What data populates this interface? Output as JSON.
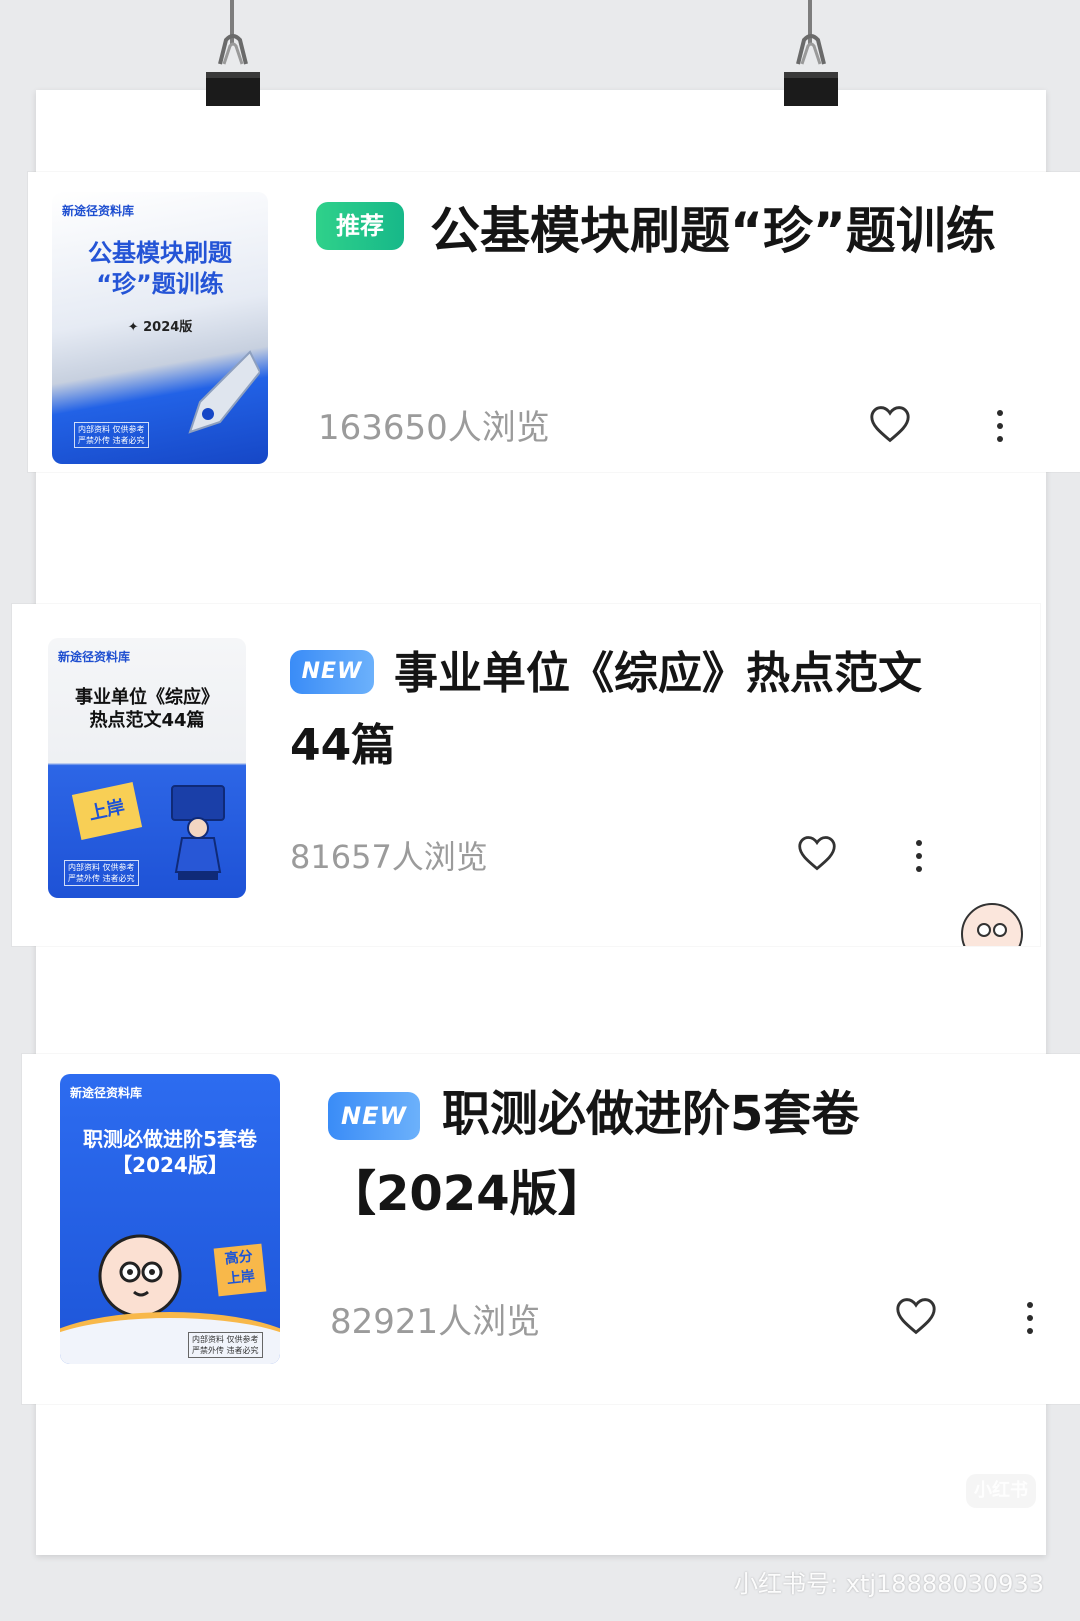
{
  "items": [
    {
      "badge": "推荐",
      "title": "公基模块刷题“珍”题训练",
      "views": "163650人浏览",
      "cover": {
        "brand": "新途径资料库",
        "title_line1": "公基模块刷题",
        "title_line2": "“珍”题训练",
        "edition": "✦ 2024版",
        "fine_1": "内部资料 仅供参考",
        "fine_2": "严禁外传 违者必究"
      }
    },
    {
      "badge": "NEW",
      "title": "事业单位《综应》热点范文44篇",
      "views": "81657人浏览",
      "cover": {
        "brand": "新途径资料库",
        "title_line1": "事业单位《综应》",
        "title_line2": "热点范文44篇",
        "sticker": "上岸",
        "fine_1": "内部资料 仅供参考",
        "fine_2": "严禁外传 违者必究"
      }
    },
    {
      "badge": "NEW",
      "title": "职测必做进阶5套卷【2024版】",
      "views": "82921人浏览",
      "cover": {
        "brand": "新途径资料库",
        "title_line1": "职测必做进阶5套卷",
        "title_line2": "【2024版】",
        "tag": "高分上岸",
        "fine_1": "内部资料 仅供参考",
        "fine_2": "严禁外传 违者必究"
      }
    }
  ],
  "watermark": {
    "logo": "小红书",
    "text": "小红书号: xtj18888030933"
  },
  "colors": {
    "badge_recommend": "#1fc38a",
    "badge_new": "#4a9bf8",
    "cover_blue": "#1f5be0",
    "views_gray": "#9b9b9b"
  },
  "icons": [
    "heart-icon",
    "more-vertical-icon",
    "binder-clip-icon",
    "cartoon-face-icon"
  ]
}
